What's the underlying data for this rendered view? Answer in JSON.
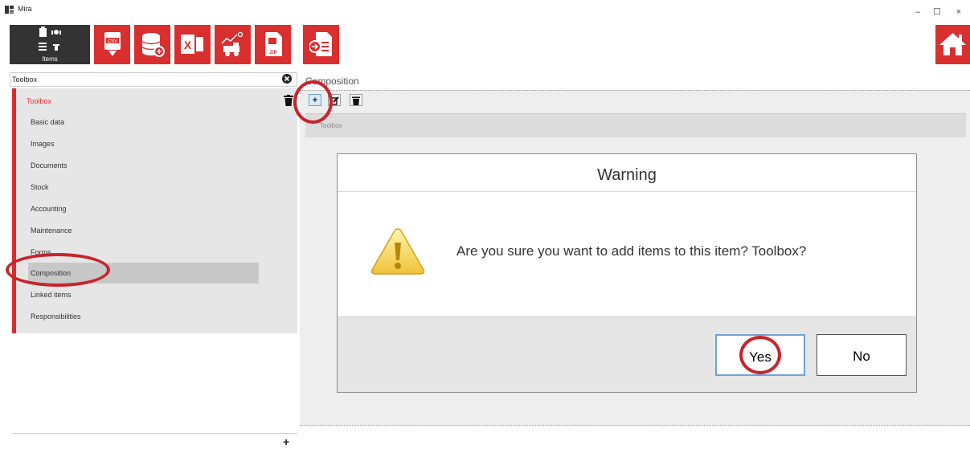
{
  "window": {
    "title": "Mira",
    "controls": {
      "minimize": "–",
      "maximize": "☐",
      "close": "×"
    }
  },
  "toolbar": {
    "items_label": "Items",
    "buttons": [
      {
        "name": "csv-export-button",
        "icon": "csv-icon",
        "text": "CSV"
      },
      {
        "name": "database-add-button",
        "icon": "database-icon"
      },
      {
        "name": "excel-button",
        "icon": "excel-icon",
        "text": "X"
      },
      {
        "name": "tow-truck-button",
        "icon": "truck-chart-icon"
      },
      {
        "name": "zip-button",
        "icon": "zip-icon",
        "text": "ZIP"
      },
      {
        "name": "import-document-button",
        "icon": "import-document-icon"
      }
    ],
    "home_icon": "home-icon"
  },
  "search": {
    "value": "Toolbox"
  },
  "left_panel": {
    "header": "Toolbox",
    "items": [
      "Basic data",
      "Images",
      "Documents",
      "Stock",
      "Accounting",
      "Maintenance",
      "Forms",
      "Composition",
      "Linked items",
      "Responsibilities"
    ],
    "selected": "Composition",
    "add_label": "+"
  },
  "composition": {
    "title": "Composition",
    "add_label": "+",
    "edit_label": "✎",
    "delete_label": "🗑",
    "list_label": "Toolbox"
  },
  "dialog": {
    "title": "Warning",
    "message": "Are you sure you want to add items to this item? Toolbox?",
    "yes_label": "Yes",
    "no_label": "No"
  },
  "colors": {
    "accent": "#d92f2f",
    "highlight_circle": "#c8242b",
    "toolbar_dark": "#333333"
  }
}
